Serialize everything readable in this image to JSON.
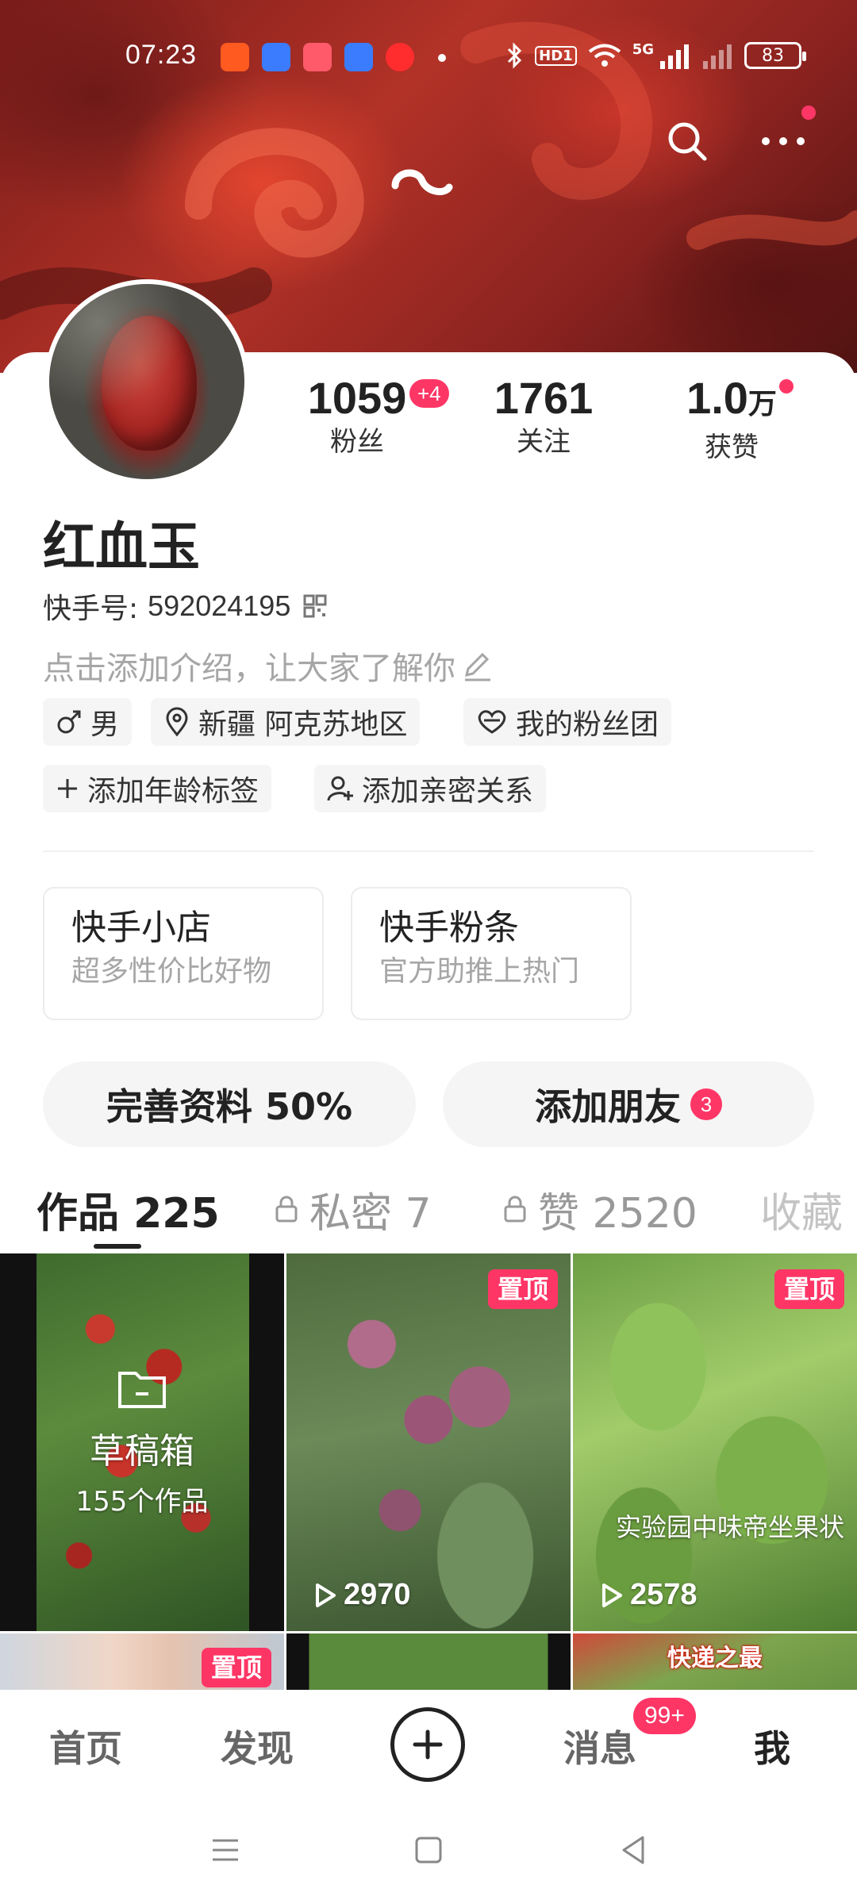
{
  "status_bar": {
    "time": "07:23",
    "network": "5G",
    "battery": "83",
    "hd_label": "HD1"
  },
  "profile": {
    "name": "红血玉",
    "kuaishou_id_label": "快手号:",
    "kuaishou_id": "592024195",
    "bio_placeholder": "点击添加介绍，让大家了解你",
    "stats": [
      {
        "value": "1059",
        "label": "粉丝",
        "badge": "+4"
      },
      {
        "value": "1761",
        "label": "关注"
      },
      {
        "value": "1.0",
        "unit": "万",
        "label": "获赞"
      }
    ],
    "tags": {
      "gender": "男",
      "location": "新疆 阿克苏地区",
      "fan_group": "我的粉丝团",
      "add_age": "添加年龄标签",
      "add_relation": "添加亲密关系"
    }
  },
  "services": [
    {
      "title": "快手小店",
      "subtitle": "超多性价比好物"
    },
    {
      "title": "快手粉条",
      "subtitle": "官方助推上热门"
    }
  ],
  "actions": {
    "complete_profile": "完善资料 50%",
    "add_friends": "添加朋友",
    "add_friends_badge": "3"
  },
  "tabs": [
    {
      "label": "作品 225",
      "active": true
    },
    {
      "label": "私密 7",
      "locked": true
    },
    {
      "label": "赞 2520",
      "locked": true
    },
    {
      "label": "收藏"
    }
  ],
  "grid": {
    "draft_title": "草稿箱",
    "draft_count": "155个作品",
    "pinned_label": "置顶",
    "items": [
      {
        "plays": "2970",
        "pinned": true
      },
      {
        "plays": "2578",
        "pinned": true,
        "caption": "实验园中味帝坐果状"
      }
    ],
    "row2_caption": "快递之最"
  },
  "bottom_nav": {
    "home": "首页",
    "discover": "发现",
    "messages": "消息",
    "messages_badge": "99+",
    "me": "我"
  },
  "colors": {
    "accent": "#fe3666",
    "text_primary": "#222222",
    "text_secondary": "#a6a6a6"
  }
}
